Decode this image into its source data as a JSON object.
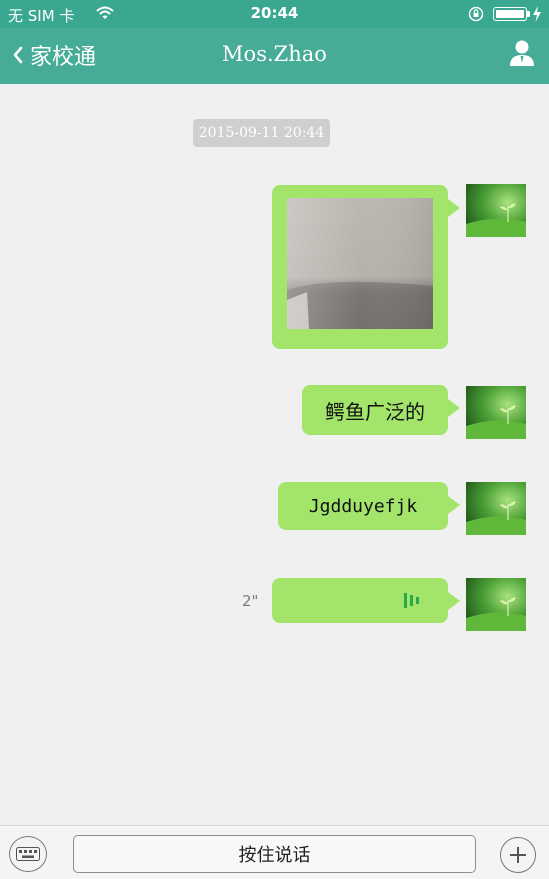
{
  "status_bar": {
    "carrier": "无 SIM 卡",
    "time": "20:44",
    "battery_level": 1.0
  },
  "nav": {
    "back_label": "家校通",
    "title": "Mos.Zhao"
  },
  "chat": {
    "timestamp": "2015-09-11 20:44",
    "messages": [
      {
        "type": "image"
      },
      {
        "type": "text",
        "text": "鳄鱼广泛的"
      },
      {
        "type": "text",
        "text": "Jgdduyefjk"
      },
      {
        "type": "voice",
        "duration": "2\""
      }
    ]
  },
  "input_bar": {
    "hold_to_talk_label": "按住说话"
  },
  "colors": {
    "header": "#46ac97",
    "status_bar": "#3aa891",
    "bubble": "#a3e56b",
    "background": "#f0f0f0"
  },
  "icons": [
    "wifi-icon",
    "rotation-lock-icon",
    "battery-icon",
    "charging-icon",
    "back-chevron-icon",
    "person-icon",
    "keyboard-icon",
    "plus-icon",
    "voice-wave-icon"
  ]
}
